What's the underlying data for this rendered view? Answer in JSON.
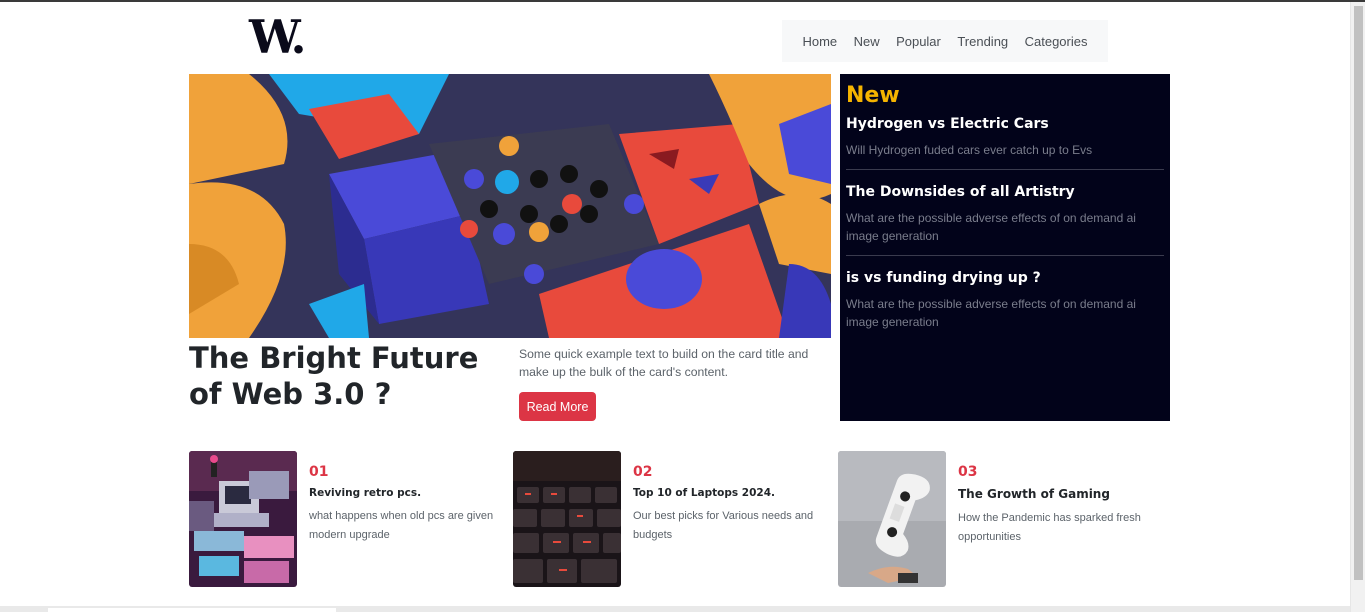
{
  "brand": {
    "logo_text": "W."
  },
  "nav": {
    "items": [
      "Home",
      "New",
      "Popular",
      "Trending",
      "Categories"
    ]
  },
  "hero": {
    "title": "The Bright Future of Web 3.0 ?",
    "text": "Some quick example text to build on the card title and make up the bulk of the card's content.",
    "button_label": "Read More",
    "image_icon": "colorful-3d-blocks-image"
  },
  "new_panel": {
    "heading": "New",
    "heading_color": "#f5b400",
    "items": [
      {
        "title": "Hydrogen vs Electric Cars",
        "desc": "Will Hydrogen fuded cars ever catch up to Evs"
      },
      {
        "title": "The Downsides of all Artistry",
        "desc": "What are the possible adverse effects of on demand ai image generation"
      },
      {
        "title": "is vs funding drying up ?",
        "desc": "What are the possible adverse effects of on demand ai image generation"
      }
    ]
  },
  "cards": [
    {
      "num": "01",
      "title": "Reviving retro pcs.",
      "desc": "what happens when old pcs are given modern upgrade",
      "image_icon": "retro-computer-image"
    },
    {
      "num": "02",
      "title": "Top 10 of Laptops 2024.",
      "desc": "Our best picks for Various needs and budgets",
      "image_icon": "keyboard-image"
    },
    {
      "num": "03",
      "title": "The Growth of Gaming",
      "desc": "How the Pandemic has sparked fresh opportunities",
      "image_icon": "game-controller-image"
    }
  ],
  "colors": {
    "accent": "#dc3545",
    "panel_bg": "#02031a"
  }
}
